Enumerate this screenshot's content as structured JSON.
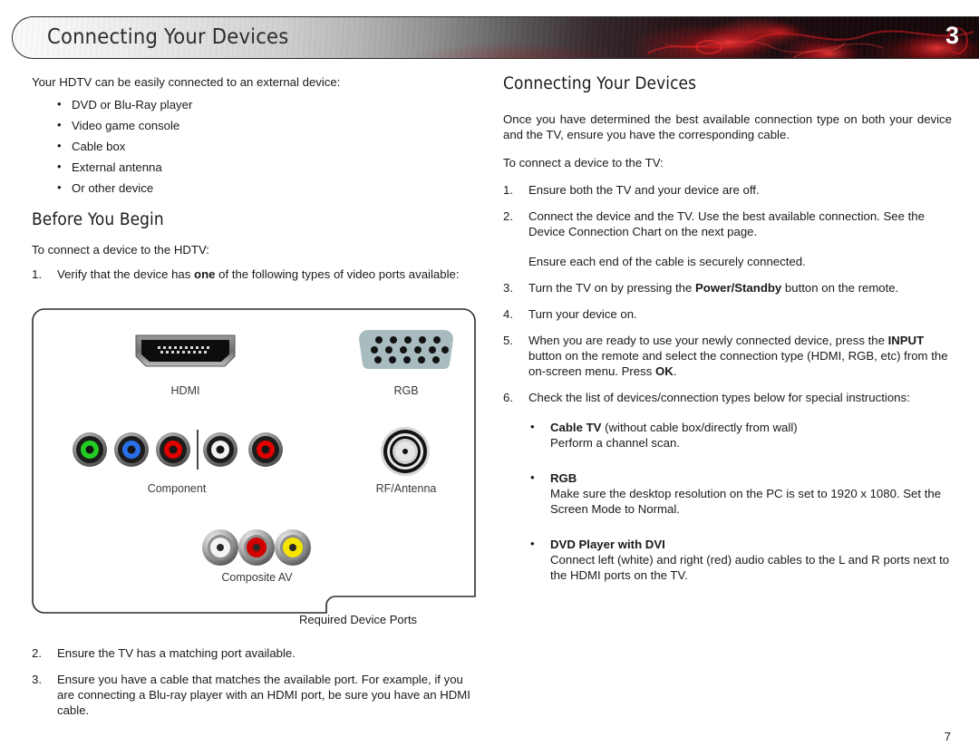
{
  "banner": {
    "title": "Connecting Your Devices",
    "chapter": "3"
  },
  "page_number": "7",
  "left_column": {
    "intro": "Your HDTV can be easily connected to an external device:",
    "device_list": [
      "DVD or Blu-Ray player",
      "Video game console",
      "Cable box",
      "External antenna",
      "Or other device"
    ],
    "section_heading": "Before You Begin",
    "connect_intro": "To connect a device to the HDTV:",
    "step1_prefix": "Verify that the device has ",
    "step1_bold": "one",
    "step1_suffix": " of the following types of video ports available:",
    "step1_num": "1.",
    "step2_num": "2.",
    "step2_text": "Ensure the TV has a matching port available.",
    "step3_num": "3.",
    "step3_text": "Ensure you have a cable that matches the available port. For example, if you are connecting a Blu-ray player with an HDMI port, be sure you have an HDMI cable."
  },
  "port_diagram": {
    "caption": "Required Device Ports",
    "labels": {
      "hdmi": "HDMI",
      "rgb": "RGB",
      "component": "Component",
      "rf_antenna": "RF/Antenna",
      "composite": "Composite AV"
    },
    "component_jacks": [
      "green",
      "blue",
      "red",
      "white",
      "red"
    ],
    "composite_jacks": [
      "white",
      "red",
      "yellow"
    ],
    "colors": {
      "green": "#22cc22",
      "blue": "#2a6fe8",
      "red": "#e00000",
      "white": "#f2f2f2",
      "yellow": "#f5e400",
      "rgb_shell": "#a8bcbf",
      "hdmi_shell": "#7b7b7b",
      "hdmi_body": "#111111"
    },
    "rgb_pin_rows": [
      5,
      5,
      5
    ]
  },
  "right_column": {
    "heading": "Connecting Your Devices",
    "para1": "Once you have determined the best available connection type on both your device and the TV, ensure you have the corresponding cable.",
    "para2": "To connect a device to the TV:",
    "steps": [
      {
        "num": "1.",
        "text": "Ensure both the TV and your device are off."
      },
      {
        "num": "2.",
        "text": "Connect the device and the TV. Use the best available connection. See the Device Connection Chart on the next page.",
        "sub": "Ensure each end of the cable is securely connected."
      },
      {
        "num": "3.",
        "pre": "Turn the TV on by pressing the ",
        "bold": "Power/Standby",
        "post": " button on the remote."
      },
      {
        "num": "4.",
        "text": "Turn your device on."
      },
      {
        "num": "5.",
        "pre": "When you are ready to use your newly connected device, press the ",
        "bold": "INPUT",
        "mid": " button on the remote and select the connection type (HDMI, RGB, etc) from the on-screen menu. Press ",
        "bold2": "OK",
        "post": "."
      },
      {
        "num": "6.",
        "text": "Check the list of devices/connection types below for special instructions:"
      }
    ],
    "bullets": [
      {
        "bold": "Cable TV",
        "inline": " (without cable box/directly from wall)",
        "detail": "Perform a channel scan."
      },
      {
        "bold": "RGB",
        "inline": "",
        "detail": "Make sure the desktop resolution on the PC is set to 1920 x 1080. Set the Screen Mode to Normal."
      },
      {
        "bold": "DVD Player with DVI",
        "inline": "",
        "detail": "Connect left (white) and right (red) audio cables to the L and R ports next to the HDMI ports on the TV."
      }
    ]
  }
}
